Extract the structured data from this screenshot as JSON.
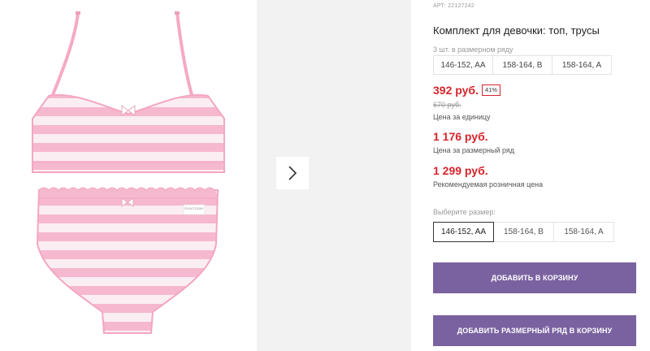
{
  "product": {
    "article": "АРТ: 22127242",
    "title": "Комплект для девочки: топ, трусы",
    "row_label": "3 шт. в размерном ряду",
    "row_sizes": [
      "146-152, AA",
      "158-164, B",
      "158-164, A"
    ],
    "price_unit": "392 руб.",
    "discount": "41%",
    "old_price": "670 руб.",
    "unit_label": "Цена за единицу",
    "price_row": "1 176 руб.",
    "row_price_label": "Цена за размерный ряд",
    "price_retail": "1 299 руб.",
    "retail_label": "Рекомендуемая розничная цена",
    "choose_size_label": "Выберите размер:",
    "size_options": [
      "146-152, AA",
      "158-164, B",
      "158-164, A"
    ],
    "selected_size": "146-152, AA",
    "add_to_cart": "ДОБАВИТЬ В КОРЗИНУ",
    "add_row_to_cart": "ДОБАВИТЬ РАЗМЕРНЫЙ РЯД В КОРЗИНУ",
    "tag_text": "PLAYTODAY"
  },
  "gallery": {
    "next_icon": "chevron-right-icon"
  },
  "colors": {
    "price_red": "#d6252b",
    "button_purple": "#7a62a0",
    "stripe_pink": "#f6b8cf",
    "stripe_white": "#fbeef3"
  }
}
